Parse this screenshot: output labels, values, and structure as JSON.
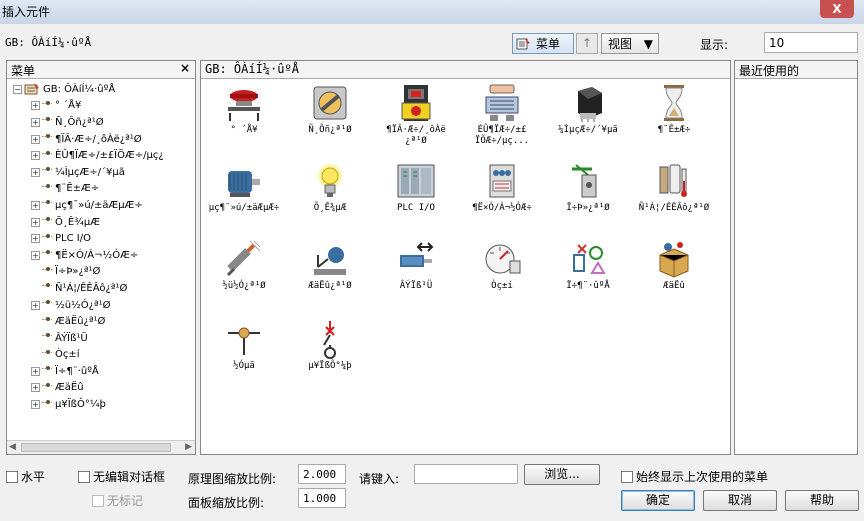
{
  "window": {
    "title": "插入元件",
    "close_glyph": "X"
  },
  "toolbar": {
    "path_label": "GB: Ô­ÀíÍ¼·ûºÅ",
    "menu_label": "菜单",
    "up_glyph": "↑",
    "view_label": "视图",
    "show_label": "显示:",
    "show_value": "10"
  },
  "left_pane": {
    "header": "菜单",
    "close_glyph": "×",
    "root_label": "GB: Ô­ÀíÍ¼·ûºÅ",
    "items": [
      {
        "label": "° ´Å¥",
        "expandable": true
      },
      {
        "label": "Ñ¸Ôñ¿ª¹Ø",
        "expandable": true
      },
      {
        "label": "¶ÏÂ·Æ÷/¸ôÀë¿ª¹Ø",
        "expandable": true
      },
      {
        "label": "ÈÛ¶ÏÆ÷/±£ÏÕÆ÷/µç¿",
        "expandable": true
      },
      {
        "label": "¼ÌµçÆ÷/´¥µã",
        "expandable": true
      },
      {
        "label": "¶¨Ê±Æ÷",
        "expandable": false
      },
      {
        "label": "µç¶¯»ú/±äÆµÆ÷",
        "expandable": true
      },
      {
        "label": "Õ¸Ê¾µÆ",
        "expandable": true
      },
      {
        "label": "PLC I/O",
        "expandable": true
      },
      {
        "label": "¶Ë×Ó/Á¬½ÓÆ÷",
        "expandable": true
      },
      {
        "label": "Ï÷Þ»¿ª¹Ø",
        "expandable": false
      },
      {
        "label": "Ñ¹Á¦/ÊÊÂô¿ª¹Ø",
        "expandable": false
      },
      {
        "label": "½ü½Ó¿ª¹Ø",
        "expandable": true
      },
      {
        "label": "ÆäËû¿ª¹Ø",
        "expandable": false
      },
      {
        "label": "ÂÝÏß¹Ü",
        "expandable": false
      },
      {
        "label": "Òç±í",
        "expandable": false
      },
      {
        "label": "Ï÷¶¨·ûºÅ",
        "expandable": true
      },
      {
        "label": "ÆäËû",
        "expandable": true
      },
      {
        "label": "µ¥ÏßÔ°¼þ",
        "expandable": true
      }
    ]
  },
  "middle_pane": {
    "header": "GB: Ô­ÀíÍ¼·ûºÅ",
    "icons": [
      {
        "name": "pushbutton-icon",
        "label": "° ´Å¥"
      },
      {
        "name": "selector-switch-icon",
        "label": "Ñ¸Ôñ¿ª¹Ø"
      },
      {
        "name": "circuit-breaker-icon",
        "label": "¶ÏÂ·Æ÷/¸ôÀë|¿ª¹Ø"
      },
      {
        "name": "fuse-transformer-icon",
        "label": "ÈÛ¶ÏÆ÷/±£|ÏÕÆ÷/µç..."
      },
      {
        "name": "relay-icon",
        "label": "¼ÌµçÆ÷/´¥µã"
      },
      {
        "name": "hourglass-icon",
        "label": "¶¨Ê±Æ÷"
      },
      {
        "name": "motor-icon",
        "label": "µç¶¯»ú/±äÆµÆ÷"
      },
      {
        "name": "lamp-icon",
        "label": "Õ¸Ê¾µÆ"
      },
      {
        "name": "plc-icon",
        "label": "PLC I/O"
      },
      {
        "name": "terminal-icon",
        "label": "¶Ë×Ó/Á¬½ÓÆ÷"
      },
      {
        "name": "limit-switch-icon",
        "label": "Ï÷Þ»¿ª¹Ø"
      },
      {
        "name": "pressure-temp-icon",
        "label": "Ñ¹Á¦/ÊÊÂô¿ª¹Ø"
      },
      {
        "name": "proximity-sensor-icon",
        "label": "½ü½Ó¿ª¹Ø"
      },
      {
        "name": "other-switch-icon",
        "label": "ÆäËû¿ª¹Ø"
      },
      {
        "name": "solenoid-icon",
        "label": "ÂÝÏß¹Ü"
      },
      {
        "name": "gauge-icon",
        "label": "Òç±í"
      },
      {
        "name": "special-symbol-icon",
        "label": "Ï÷¶¨·ûºÅ"
      },
      {
        "name": "misc-box-icon",
        "label": "ÆäËû"
      },
      {
        "name": "connection-point-icon",
        "label": "½Óµã"
      },
      {
        "name": "single-line-icon",
        "label": "µ¥ÏßÔ°¼þ"
      }
    ]
  },
  "right_pane": {
    "header": "最近使用的"
  },
  "bottom": {
    "horizontal_label": "水平",
    "no_edit_dialog_label": "无编辑对话框",
    "no_tag_label": "无标记",
    "schematic_scale_label": "原理图缩放比例:",
    "schematic_scale_value": "2.000",
    "panel_scale_label": "面板缩放比例:",
    "panel_scale_value": "1.000",
    "key_in_label": "请键入:",
    "key_in_value": "",
    "browse_label": "浏览...",
    "always_show_label": "始终显示上次使用的菜单",
    "ok_label": "确定",
    "cancel_label": "取消",
    "help_label": "帮助"
  }
}
